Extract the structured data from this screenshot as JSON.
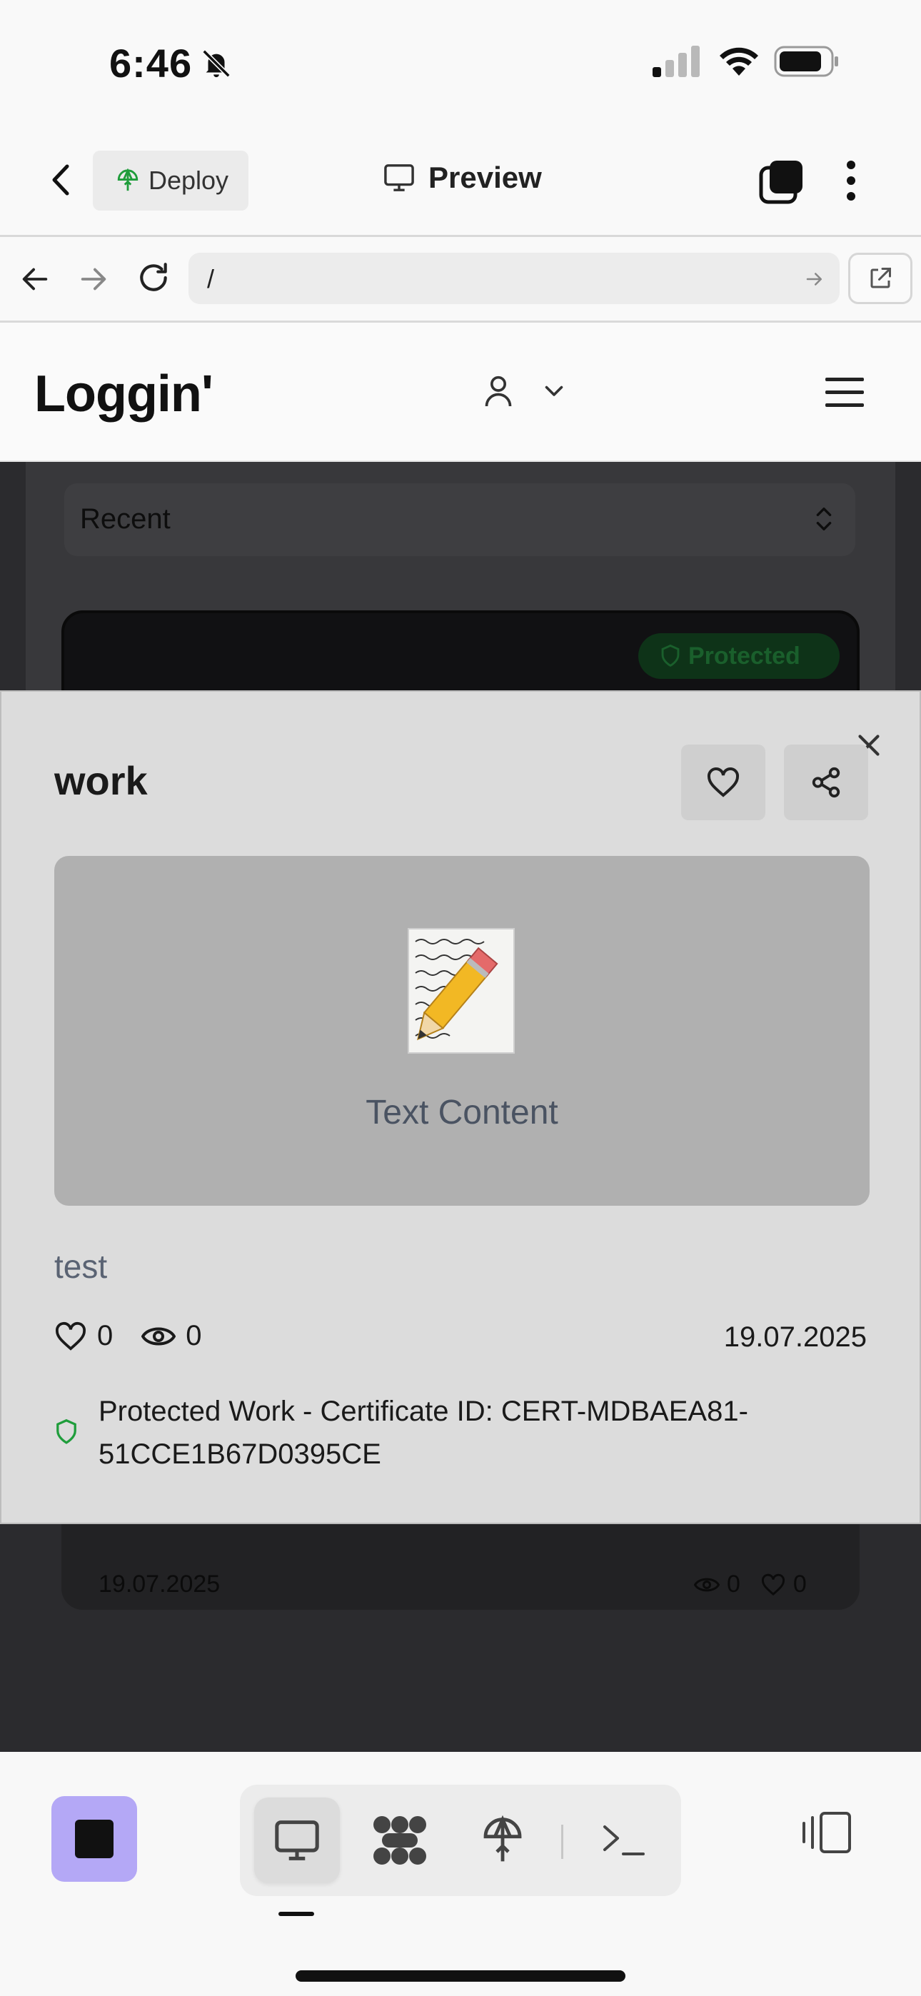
{
  "status_bar": {
    "time": "6:46"
  },
  "app_header": {
    "deploy_label": "Deploy",
    "preview_label": "Preview"
  },
  "url_bar": {
    "url": "/"
  },
  "site": {
    "logo": "Loggin'",
    "sort": {
      "selected": "Recent"
    },
    "background_item": {
      "badge": "Protected",
      "date": "19.07.2025",
      "views": "0",
      "likes": "0"
    }
  },
  "modal": {
    "title": "work",
    "preview_caption": "Text Content",
    "description": "test",
    "likes": "0",
    "views": "0",
    "date": "19.07.2025",
    "certificate_text": "Protected Work - Certificate ID: CERT-MDBAEA81-51CCE1B67D0395CE"
  },
  "colors": {
    "stop_button": "#b4a8f6",
    "protected_green": "#1f9d3b",
    "modal_bg": "#dcdcdc",
    "overlay_bg": "#2b2b2e"
  }
}
